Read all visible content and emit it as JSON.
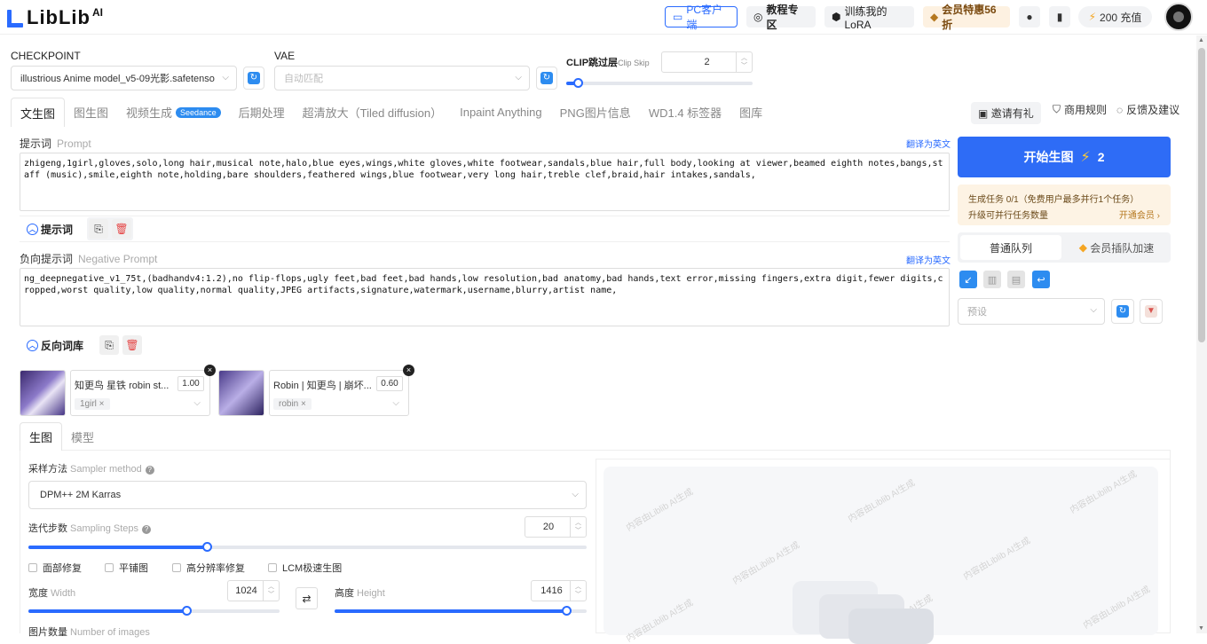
{
  "header": {
    "logo_text": "LibLib",
    "logo_suffix": "AI",
    "pc_client": "PC客户端",
    "tutorial": "教程专区",
    "train_lora": "训练我的LoRA",
    "vip_offer": "会员特惠56折",
    "recharge": "200 充值"
  },
  "model": {
    "checkpoint_label": "CHECKPOINT",
    "checkpoint_value": "illustrious Anime model_v5-09光影.safetenso",
    "vae_label": "VAE",
    "vae_placeholder": "自动匹配",
    "clip_label": "CLIP跳过层",
    "clip_label_en": "Clip Skip",
    "clip_value": "2",
    "clip_fraction": 0.06
  },
  "tabs": [
    "文生图",
    "图生图",
    "视频生成",
    "后期处理",
    "超清放大（Tiled diffusion）",
    "Inpaint Anything",
    "PNG图片信息",
    "WD1.4 标签器",
    "图库"
  ],
  "tab_badge": "Seedance",
  "right_links": {
    "invite": "邀请有礼",
    "commercial": "商用规则",
    "feedback": "反馈及建议"
  },
  "prompt": {
    "label": "提示词",
    "label_en": "Prompt",
    "translate": "翻译为英文",
    "text": "zhigeng,1girl,gloves,solo,long hair,musical note,halo,blue eyes,wings,white gloves,white footwear,sandals,blue hair,full body,looking at viewer,beamed eighth notes,bangs,staff (music),smile,eighth note,holding,bare shoulders,feathered wings,blue footwear,very long hair,treble clef,braid,hair intakes,sandals,",
    "collapse_label": "提示词"
  },
  "negative": {
    "label": "负向提示词",
    "label_en": "Negative Prompt",
    "translate": "翻译为英文",
    "text": "ng_deepnegative_v1_75t,(badhandv4:1.2),no flip-flops,ugly feet,bad feet,bad hands,low resolution,bad anatomy,bad hands,text error,missing fingers,extra digit,fewer digits,cropped,worst quality,low quality,normal quality,JPEG artifacts,signature,watermark,username,blurry,artist name,",
    "collapse_label": "反向词库"
  },
  "generate": {
    "label": "开始生图",
    "cost": "2"
  },
  "task": {
    "line1": "生成任务 0/1（免费用户最多并行1个任务）",
    "line2": "升级可并行任务数量",
    "link": "开通会员 ›"
  },
  "queue": {
    "normal": "普通队列",
    "vip": "会员插队加速"
  },
  "preset": {
    "placeholder": "预设"
  },
  "loras": [
    {
      "name": "知更鸟 星铁 robin st...",
      "weight": "1.00",
      "tag": "1girl"
    },
    {
      "name": "Robin | 知更鸟 | 崩坏...",
      "weight": "0.60",
      "tag": "robin"
    }
  ],
  "sub_tabs": [
    "生图",
    "模型"
  ],
  "sampler": {
    "label": "采样方法",
    "label_en": "Sampler method",
    "value": "DPM++ 2M Karras"
  },
  "steps": {
    "label": "迭代步数",
    "label_en": "Sampling Steps",
    "value": "20",
    "fraction": 0.32
  },
  "checks": [
    "面部修复",
    "平铺图",
    "高分辨率修复",
    "LCM极速生图"
  ],
  "width": {
    "label": "宽度",
    "label_en": "Width",
    "value": "1024",
    "fraction": 0.63
  },
  "height": {
    "label": "高度",
    "label_en": "Height",
    "value": "1416",
    "fraction": 0.92
  },
  "count": {
    "label": "图片数量",
    "label_en": "Number of images"
  },
  "watermark": "内容由Liblib AI生成",
  "colors": {
    "accent": "#2a6bff",
    "generate_bg": "#2e6cf6",
    "vip_bg": "#fdf1e1"
  }
}
